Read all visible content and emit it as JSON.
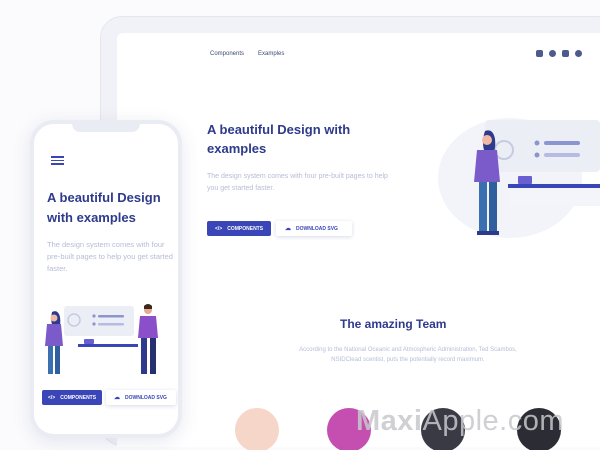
{
  "desktop": {
    "nav": [
      "Components",
      "Examples"
    ],
    "social_icons": [
      "facebook-icon",
      "instagram-icon",
      "twitter-icon",
      "github-icon"
    ],
    "hero": {
      "title": "A beautiful Design with examples",
      "text": "The design system comes with four pre-built pages to help you get started faster.",
      "primary_button": "Components",
      "secondary_button": "Download SVG"
    },
    "team": {
      "title": "The amazing Team",
      "text": "According to the National Oceanic and Atmospheric Administration, Ted Scambos, NSIDClead scentist, puts the potentially record maximum."
    }
  },
  "mobile": {
    "menu_icon": "hamburger-icon",
    "hero": {
      "title": "A beautiful Design with examples",
      "text": "The design system comes with four pre-built pages to help you get started faster.",
      "primary_button": "Components",
      "secondary_button": "Download SVG"
    }
  },
  "watermark": {
    "bold": "Maxi",
    "light": "Apple.com"
  },
  "colors": {
    "accent": "#3a46b8",
    "heading": "#2e3a8c",
    "muted": "#b7bcd6",
    "figure": "#7a5bc9"
  }
}
